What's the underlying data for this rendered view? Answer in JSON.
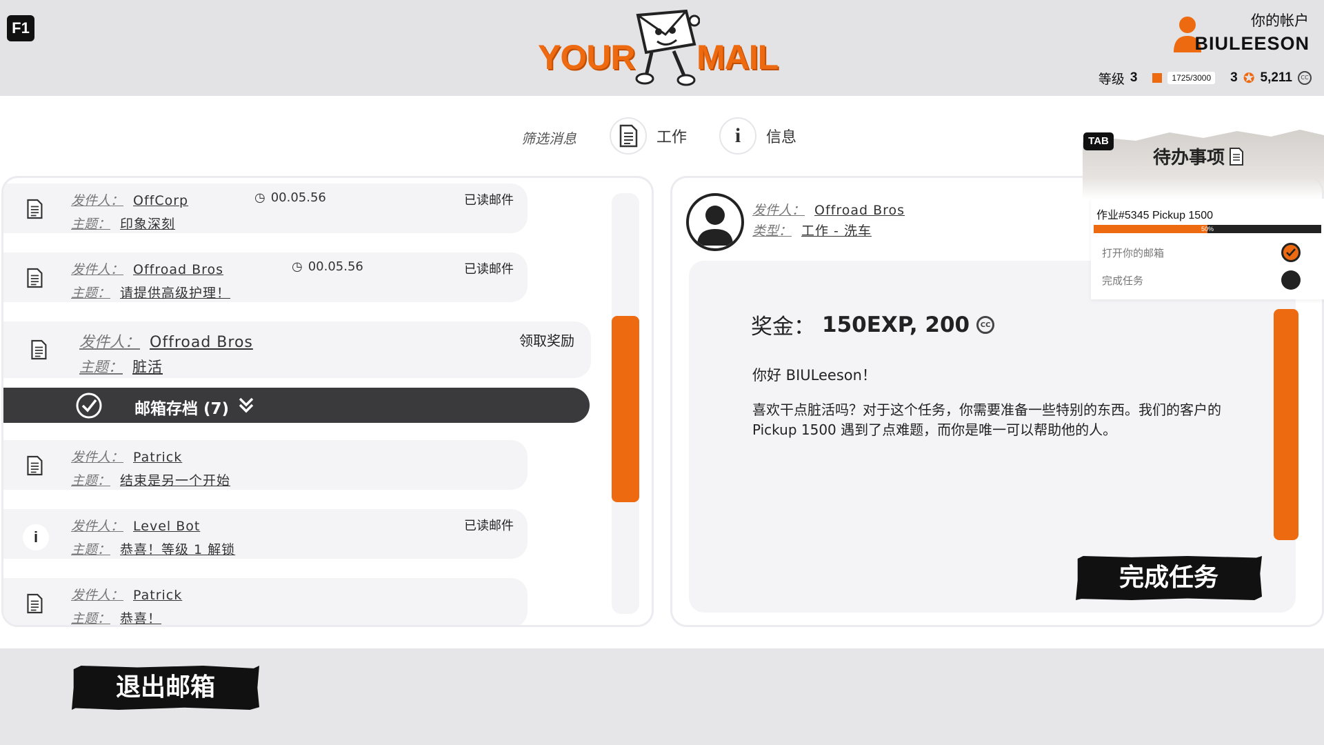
{
  "header": {
    "f1_key": "F1",
    "logo_left": "YOUR",
    "logo_right": "MAIL",
    "account_title": "你的帐户",
    "account_name": "BIULEESON",
    "level_label": "等级",
    "level_value": "3",
    "xp_text": "1725/3000",
    "stars_value": "3",
    "coins_value": "5,211",
    "coin_symbol": "CC"
  },
  "filter": {
    "label": "筛选消息",
    "work_label": "工作",
    "info_label": "信息"
  },
  "labels": {
    "sender": "发件人：",
    "subject": "主题：",
    "type": "类型："
  },
  "messages": [
    {
      "sender": "OffCorp",
      "subject": "印象深刻",
      "time": "00.05.56",
      "status": "已读邮件",
      "icon": "document-icon"
    },
    {
      "sender": "Offroad Bros",
      "subject": "请提供高级护理！",
      "time": "00.05.56",
      "status": "已读邮件",
      "icon": "document-icon"
    },
    {
      "sender": "Offroad Bros",
      "subject": "脏活",
      "status": "领取奖励",
      "icon": "document-icon"
    }
  ],
  "archive": {
    "label": "邮箱存档 (7)"
  },
  "archived_messages": [
    {
      "sender": "Patrick",
      "subject": "结束是另一个开始",
      "status": "",
      "icon": "document-icon"
    },
    {
      "sender": "Level Bot",
      "subject": "恭喜！等级 1 解锁",
      "status": "已读邮件",
      "icon": "info-icon"
    },
    {
      "sender": "Patrick",
      "subject": "恭喜！",
      "status": "",
      "icon": "document-icon"
    }
  ],
  "detail": {
    "sender": "Offroad Bros",
    "type": "工作 - 洗车",
    "reward_label": "奖金：",
    "reward_value": "150EXP, 200",
    "greeting": "你好 BIULeeson！",
    "body": "喜欢干点脏活吗？对于这个任务，你需要准备一些特别的东西。我们的客户的 Pickup 1500 遇到了点难题，而你是唯一可以帮助他的人。",
    "complete_button": "完成任务"
  },
  "todo": {
    "tab_key": "TAB",
    "title": "待办事项",
    "job": "作业#5345 Pickup 1500",
    "progress": 0.5,
    "progress_text": "50%",
    "tasks": [
      {
        "label": "打开你的邮箱",
        "done": true
      },
      {
        "label": "完成任务",
        "done": false
      }
    ]
  },
  "footer": {
    "exit_button": "退出邮箱"
  },
  "colors": {
    "accent": "#ee6a10",
    "dark": "#3a3a3d",
    "header_bg": "#e3e3e6"
  }
}
